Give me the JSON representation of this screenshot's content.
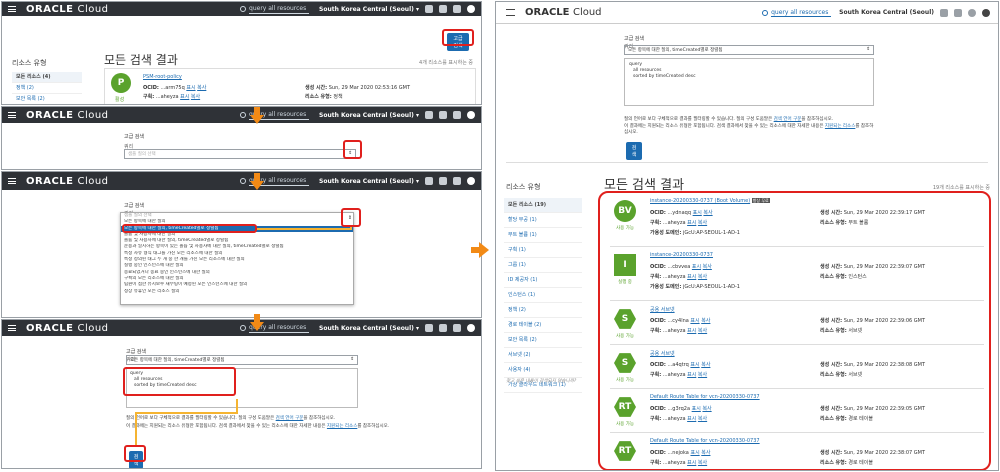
{
  "topbar": {
    "brand_bold": "ORACLE",
    "brand_light": "Cloud",
    "search_query": "query  all resources",
    "region": "South Korea Central (Seoul)"
  },
  "panel1": {
    "sidebar_title": "리소스 유형",
    "sidebar_items": [
      "모든 리소스 (4)",
      "정책 (2)",
      "보안 목록 (2)"
    ],
    "page_title": "모든 검색 결과",
    "advanced_button": "고급 검색",
    "result_count": "4개 리소스를 표시하는 중",
    "card": {
      "badge": "P",
      "state": "활성",
      "name": "PSM-root-policy",
      "ocid_label": "OCID:",
      "ocid_value": "...arm75q",
      "ocid_links": [
        "표시",
        "복사"
      ],
      "compartment_label": "구획:",
      "compartment_value": "...aheyza",
      "compartment_links": [
        "표시",
        "복사"
      ],
      "created_label": "생성 시간:",
      "created_value": "Sun, 29 Mar 2020 02:53:16 GMT",
      "type_label": "리소스 유형:",
      "type_value": "정책"
    }
  },
  "panel2": {
    "section_title": "고급 검색",
    "query_label": "쿼리",
    "select_placeholder": "샘플 질의 선택"
  },
  "panel3": {
    "section_title": "고급 검색",
    "query_label": "쿼리",
    "options": [
      "샘플 질의 선택",
      "모든 항목에 대한 질의",
      "모든 항목에 대한 질의, timeCreated별로 정렬됨",
      "볼륨 및 사용자에 대한 질의",
      "볼륨 및 사용자에 대한 질의, timeCreated별로 정렬됨",
      "운용과 일치하는 항목이 있는 볼륨 및 사용자에 대한 질의, timeCreated별로 정렬됨",
      "특정 자유 형식 태그를 가진 모든 리소스에 대한 질의",
      "특정 정의된 태그 두 개 중 한 개를 가진 모든 리소스에 대한 질의",
      "실행 중인 인스턴스에 대한 질의",
      "종료되었거나 종료 중인 인스턴스에 대한 질의",
      "구획의 모든 리소스에 대한 질의",
      "팀원이 접한 유지보수 재부팅이 예정된 모든 인스턴스에 대한 질의",
      "정상 유휴인 모든 리소스 질의"
    ]
  },
  "panel4": {
    "section_title": "고급 검색",
    "query_label": "쿼리",
    "select_value": "모든 항목에 대한 질의, timeCreated별로 정렬됨",
    "query_lines": [
      "query",
      "all resources",
      "sorted by timeCreated desc"
    ],
    "help1_prefix": "질의 언어로 보다 구체적으로 결과를 필터링할 수 있습니다. 질의 구성 도움말은",
    "help1_link": "검색 언어 구문",
    "help1_suffix": "을 참조하십시오.",
    "help2_prefix": "이 결과에는 지원되는 리소스 유형만 포함됩니다. 검색 결과에서 찾을 수 있는 리소스에 대한 자세한 내용은",
    "help2_link": "지원되는 리소스",
    "help2_suffix": "를 참조하십시오.",
    "search_button": "검색"
  },
  "main": {
    "section_title": "고급 검색",
    "query_label": "쿼리",
    "select_value": "모든 항목에 대한 질의, timeCreated별로 정렬됨",
    "query_lines": [
      "query",
      "all resources",
      "sorted by timeCreated desc"
    ],
    "help1_prefix": "질의 언어로 보다 구체적으로 결과를 필터링할 수 있습니다. 질의 구성 도움말은",
    "help1_link": "검색 언어 구문",
    "help1_suffix": "을 참조하십시오.",
    "help2_prefix": "이 결과에는 지원되는 리소스 유형만 포함됩니다. 검색 결과에서 찾을 수 있는 리소스에 대한 자세한 내용은",
    "help2_link": "지원되는 리소스",
    "help2_suffix": "를 참조하십시오.",
    "search_button": "검색",
    "sidebar_title": "리소스 유형",
    "sidebar_items": [
      "모든 리소스 (19)",
      "할당 무공 (1)",
      "부트 볼륨 (1)",
      "구획 (1)",
      "그룹 (1)",
      "ID 제공자 (1)",
      "인스턴스 (1)",
      "정책 (2)",
      "경로 테이블 (2)",
      "보안 목록 (2)",
      "서브넷 (2)",
      "사용자 (4)",
      "가상 클라우드 네트워크 (1)"
    ],
    "sidebar_footer": "찾고 싶은 내용이 검색되지 않습니까?",
    "page_title": "모든 검색 결과",
    "result_count": "19개 리소스를 표시하는 중",
    "cards": [
      {
        "badge": "BV",
        "shape": "circle",
        "state": "사용 가능",
        "name": "instance-20200330-0737 (Boot Volume)",
        "tag": "항상 무료",
        "ocid": "...ydnaqq",
        "compartment": "...aheyza",
        "extra_label": "가용성 도메인:",
        "extra_value": "jGcU:AP-SEOUL-1-AD-1",
        "created": "Sun, 29 Mar 2020 22:39:17 GMT",
        "type": "부트 볼륨"
      },
      {
        "badge": "I",
        "shape": "square",
        "state": "실행 중",
        "name": "instance-20200330-0737",
        "tag": "",
        "ocid": "...cbvvea",
        "compartment": "...aheyza",
        "extra_label": "가용성 도메인:",
        "extra_value": "jGcU:AP-SEOUL-1-AD-1",
        "created": "Sun, 29 Mar 2020 22:39:07 GMT",
        "type": "인스턴스"
      },
      {
        "badge": "S",
        "shape": "hex",
        "state": "사용 가능",
        "name": "공용 서브넷",
        "tag": "",
        "ocid": "...cy4lna",
        "compartment": "...aheyza",
        "extra_label": "",
        "extra_value": "",
        "created": "Sun, 29 Mar 2020 22:39:06 GMT",
        "type": "서브넷"
      },
      {
        "badge": "S",
        "shape": "hex",
        "state": "사용 가능",
        "name": "공용 서브넷",
        "tag": "",
        "ocid": "...a4qtrq",
        "compartment": "...aheyza",
        "extra_label": "",
        "extra_value": "",
        "created": "Sun, 29 Mar 2020 22:38:08 GMT",
        "type": "서브넷"
      },
      {
        "badge": "RT",
        "shape": "hex",
        "state": "사용 가능",
        "name": "Default Route Table for vcn-20200330-0737",
        "tag": "",
        "ocid": "...g3rq2a",
        "compartment": "...aheyza",
        "extra_label": "",
        "extra_value": "",
        "created": "Sun, 29 Mar 2020 22:39:05 GMT",
        "type": "경로 테이블"
      },
      {
        "badge": "RT",
        "shape": "hex",
        "state": "사용 가능",
        "name": "Default Route Table for vcn-20200330-0737",
        "tag": "",
        "ocid": "...nejoka",
        "compartment": "...aheyza",
        "extra_label": "",
        "extra_value": "",
        "created": "Sun, 29 Mar 2020 22:38:07 GMT",
        "type": "경로 테이블"
      }
    ],
    "labels": {
      "ocid": "OCID:",
      "compartment": "구획:",
      "show": "표시",
      "copy": "복사",
      "created": "생성 시간:",
      "type": "리소스 유형:"
    }
  },
  "colors": {
    "topbar": "#2f3237",
    "accent_blue": "#1c6bb0",
    "highlight_red": "#e0201d",
    "arrow_orange": "#f28a16",
    "badge_green": "#5aa22c"
  }
}
